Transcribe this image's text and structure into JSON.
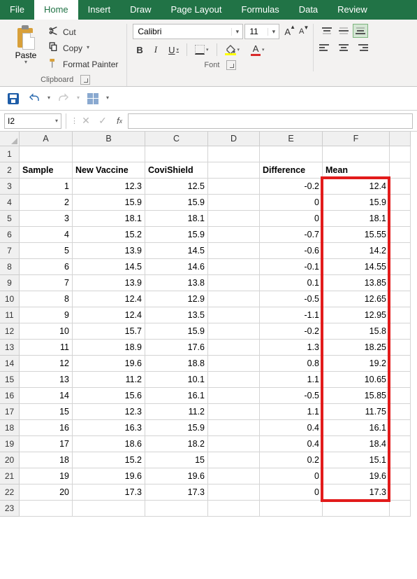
{
  "tabs": [
    "File",
    "Home",
    "Insert",
    "Draw",
    "Page Layout",
    "Formulas",
    "Data",
    "Review"
  ],
  "active_tab": "Home",
  "clipboard": {
    "paste": "Paste",
    "cut": "Cut",
    "copy": "Copy",
    "format_painter": "Format Painter",
    "group_label": "Clipboard"
  },
  "font_group": {
    "name": "Calibri",
    "size": "11",
    "group_label": "Font"
  },
  "chart_data": {
    "type": "table",
    "headers": {
      "A": "Sample",
      "B": "New Vaccine",
      "C": "CoviShield",
      "E": "Difference",
      "F": "Mean"
    },
    "rows": [
      {
        "sample": 1,
        "new_vaccine": 12.3,
        "covishield": 12.5,
        "difference": -0.2,
        "mean": 12.4
      },
      {
        "sample": 2,
        "new_vaccine": 15.9,
        "covishield": 15.9,
        "difference": 0,
        "mean": 15.9
      },
      {
        "sample": 3,
        "new_vaccine": 18.1,
        "covishield": 18.1,
        "difference": 0,
        "mean": 18.1
      },
      {
        "sample": 4,
        "new_vaccine": 15.2,
        "covishield": 15.9,
        "difference": -0.7,
        "mean": 15.55
      },
      {
        "sample": 5,
        "new_vaccine": 13.9,
        "covishield": 14.5,
        "difference": -0.6,
        "mean": 14.2
      },
      {
        "sample": 6,
        "new_vaccine": 14.5,
        "covishield": 14.6,
        "difference": -0.1,
        "mean": 14.55
      },
      {
        "sample": 7,
        "new_vaccine": 13.9,
        "covishield": 13.8,
        "difference": 0.1,
        "mean": 13.85
      },
      {
        "sample": 8,
        "new_vaccine": 12.4,
        "covishield": 12.9,
        "difference": -0.5,
        "mean": 12.65
      },
      {
        "sample": 9,
        "new_vaccine": 12.4,
        "covishield": 13.5,
        "difference": -1.1,
        "mean": 12.95
      },
      {
        "sample": 10,
        "new_vaccine": 15.7,
        "covishield": 15.9,
        "difference": -0.2,
        "mean": 15.8
      },
      {
        "sample": 11,
        "new_vaccine": 18.9,
        "covishield": 17.6,
        "difference": 1.3,
        "mean": 18.25
      },
      {
        "sample": 12,
        "new_vaccine": 19.6,
        "covishield": 18.8,
        "difference": 0.8,
        "mean": 19.2
      },
      {
        "sample": 13,
        "new_vaccine": 11.2,
        "covishield": 10.1,
        "difference": 1.1,
        "mean": 10.65
      },
      {
        "sample": 14,
        "new_vaccine": 15.6,
        "covishield": 16.1,
        "difference": -0.5,
        "mean": 15.85
      },
      {
        "sample": 15,
        "new_vaccine": 12.3,
        "covishield": 11.2,
        "difference": 1.1,
        "mean": 11.75
      },
      {
        "sample": 16,
        "new_vaccine": 16.3,
        "covishield": 15.9,
        "difference": 0.4,
        "mean": 16.1
      },
      {
        "sample": 17,
        "new_vaccine": 18.6,
        "covishield": 18.2,
        "difference": 0.4,
        "mean": 18.4
      },
      {
        "sample": 18,
        "new_vaccine": 15.2,
        "covishield": 15,
        "difference": 0.2,
        "mean": 15.1
      },
      {
        "sample": 19,
        "new_vaccine": 19.6,
        "covishield": 19.6,
        "difference": 0,
        "mean": 19.6
      },
      {
        "sample": 20,
        "new_vaccine": 17.3,
        "covishield": 17.3,
        "difference": 0,
        "mean": 17.3
      }
    ]
  },
  "name_box": "I2",
  "columns": [
    "A",
    "B",
    "C",
    "D",
    "E",
    "F"
  ],
  "highlight_column": "F",
  "first_data_row": 3,
  "last_data_row": 22
}
